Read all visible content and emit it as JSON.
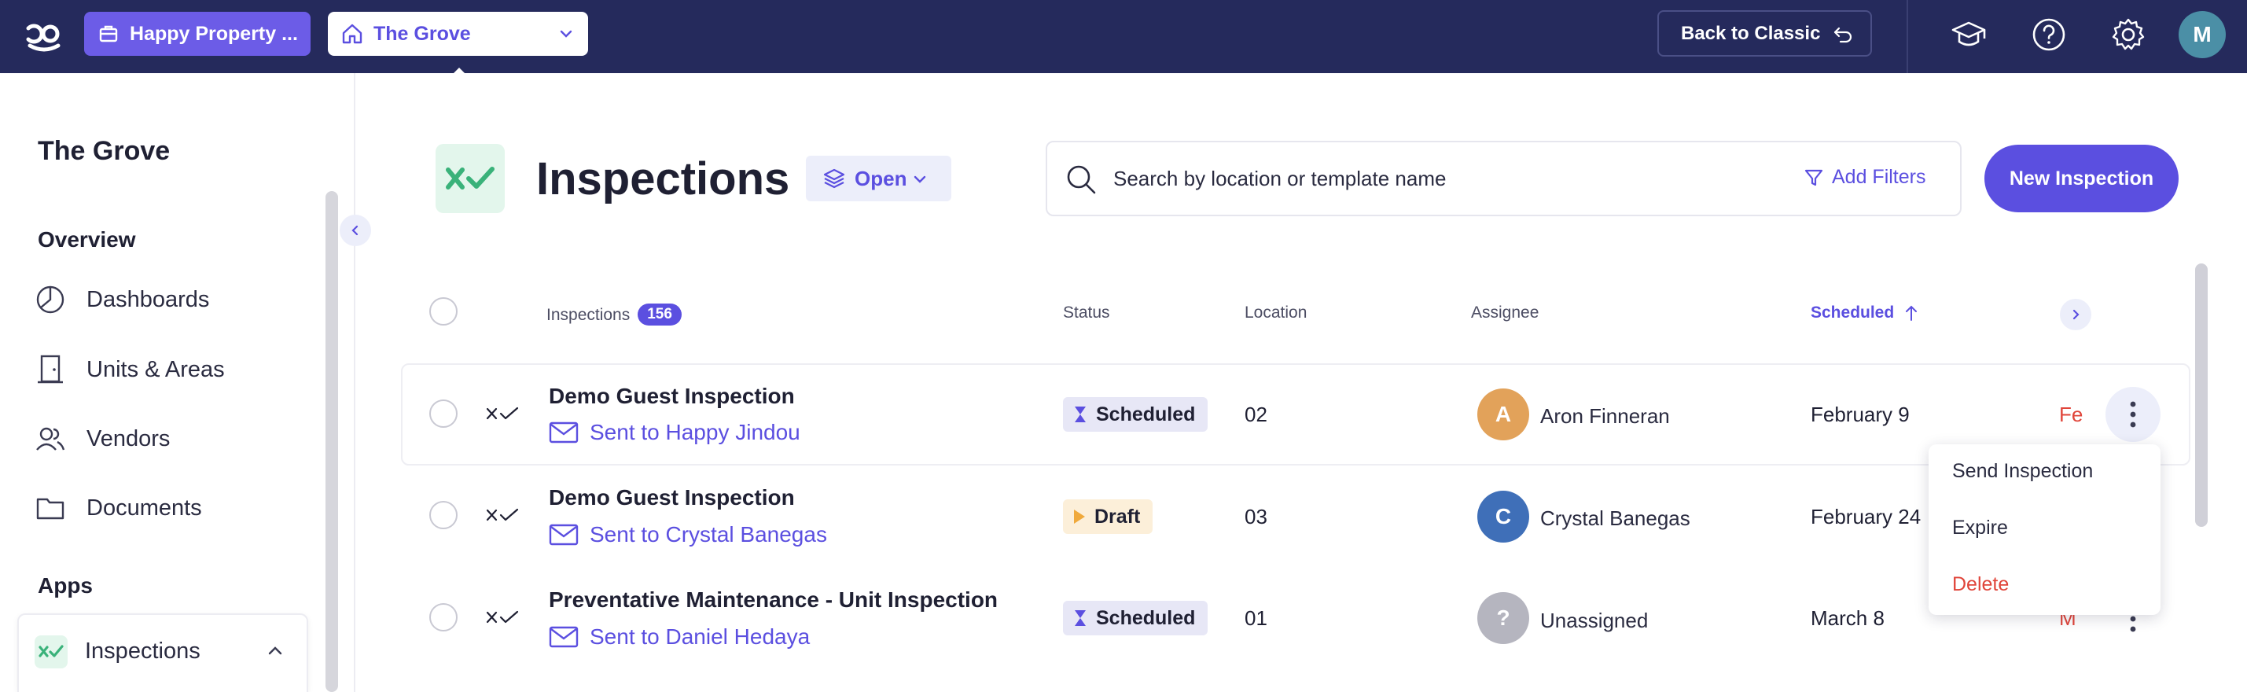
{
  "topbar": {
    "org_name": "Happy Property ...",
    "property_name": "The Grove",
    "back_to_classic": "Back to Classic",
    "user_initial": "M"
  },
  "sidebar": {
    "title": "The Grove",
    "overview_label": "Overview",
    "items": [
      {
        "label": "Dashboards",
        "icon": "dashboard-icon"
      },
      {
        "label": "Units & Areas",
        "icon": "door-icon"
      },
      {
        "label": "Vendors",
        "icon": "users-icon"
      },
      {
        "label": "Documents",
        "icon": "folder-icon"
      }
    ],
    "apps_label": "Apps",
    "active_app": "Inspections"
  },
  "main": {
    "title": "Inspections",
    "status_filter": "Open",
    "search_placeholder": "Search by location or template name",
    "add_filters": "Add Filters",
    "new_button": "New Inspection"
  },
  "table": {
    "headers": {
      "inspections": "Inspections",
      "count": "156",
      "status": "Status",
      "location": "Location",
      "assignee": "Assignee",
      "scheduled": "Scheduled"
    },
    "rows": [
      {
        "title": "Demo Guest Inspection",
        "sent_to": "Sent to Happy Jindou",
        "status": "Scheduled",
        "location": "02",
        "assignee_initial": "A",
        "assignee": "Aron Finneran",
        "scheduled": "February 9",
        "due": "Fe"
      },
      {
        "title": "Demo Guest Inspection",
        "sent_to": "Sent to Crystal Banegas",
        "status": "Draft",
        "location": "03",
        "assignee_initial": "C",
        "assignee": "Crystal Banegas",
        "scheduled": "February 24",
        "due": ""
      },
      {
        "title": "Preventative Maintenance - Unit Inspection",
        "sent_to": "Sent to Daniel Hedaya",
        "status": "Scheduled",
        "location": "01",
        "assignee_initial": "?",
        "assignee": "Unassigned",
        "scheduled": "March 8",
        "due": "M"
      }
    ]
  },
  "context_menu": {
    "send": "Send Inspection",
    "expire": "Expire",
    "delete": "Delete"
  },
  "colors": {
    "topbar": "#252a5c",
    "accent": "#5b4fe0",
    "danger": "#e0453a",
    "avatar_a": "#e2a25a",
    "avatar_c": "#3f6fb8",
    "avatar_unassigned": "#b5b5bf"
  }
}
